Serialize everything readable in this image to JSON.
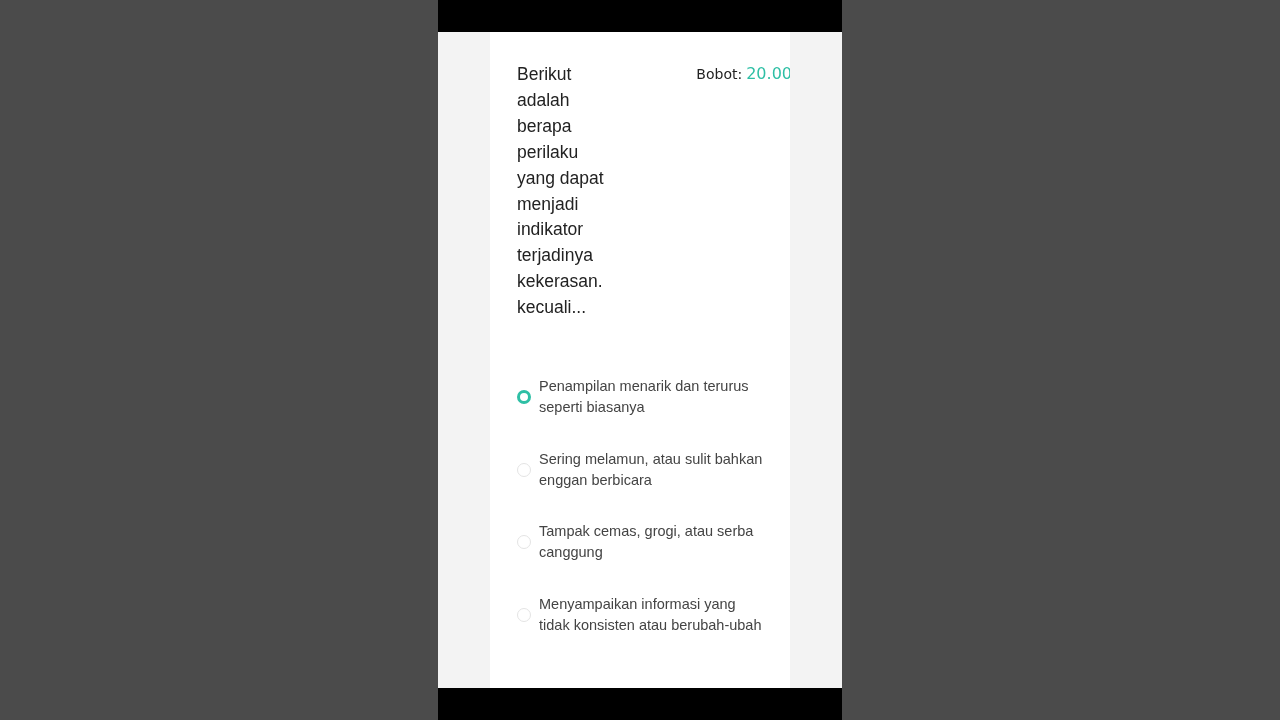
{
  "question": {
    "text": "Berikut adalah berapa perilaku yang dapat menjadi indikator terjadinya kekerasan. kecuali...",
    "weight_label": "Bobot:",
    "weight_value": "20.00"
  },
  "options": [
    {
      "text": "Penampilan menarik dan terurus seperti biasanya",
      "selected": true
    },
    {
      "text": "Sering melamun, atau sulit bahkan enggan berbicara",
      "selected": false
    },
    {
      "text": "Tampak cemas, grogi, atau serba canggung",
      "selected": false
    },
    {
      "text": "Menyampaikan informasi yang tidak konsisten atau berubah-ubah",
      "selected": false
    }
  ]
}
